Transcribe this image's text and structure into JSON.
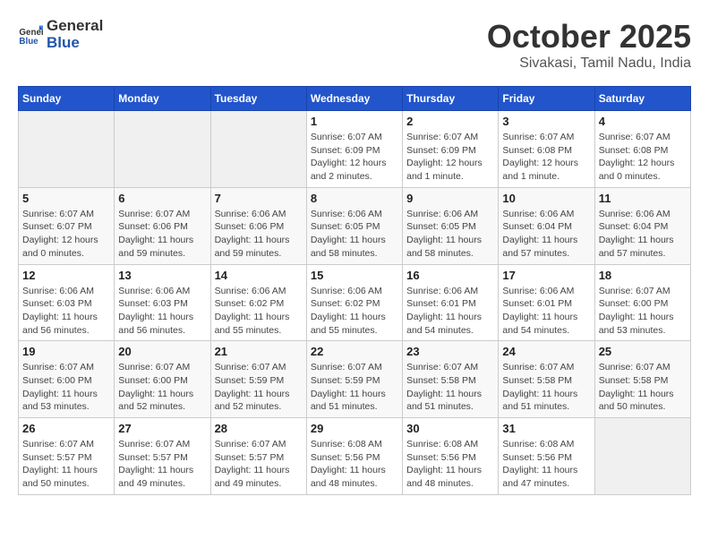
{
  "header": {
    "logo_general": "General",
    "logo_blue": "Blue",
    "title": "October 2025",
    "subtitle": "Sivakasi, Tamil Nadu, India"
  },
  "weekdays": [
    "Sunday",
    "Monday",
    "Tuesday",
    "Wednesday",
    "Thursday",
    "Friday",
    "Saturday"
  ],
  "weeks": [
    [
      {
        "day": "",
        "info": ""
      },
      {
        "day": "",
        "info": ""
      },
      {
        "day": "",
        "info": ""
      },
      {
        "day": "1",
        "info": "Sunrise: 6:07 AM\nSunset: 6:09 PM\nDaylight: 12 hours and 2 minutes."
      },
      {
        "day": "2",
        "info": "Sunrise: 6:07 AM\nSunset: 6:09 PM\nDaylight: 12 hours and 1 minute."
      },
      {
        "day": "3",
        "info": "Sunrise: 6:07 AM\nSunset: 6:08 PM\nDaylight: 12 hours and 1 minute."
      },
      {
        "day": "4",
        "info": "Sunrise: 6:07 AM\nSunset: 6:08 PM\nDaylight: 12 hours and 0 minutes."
      }
    ],
    [
      {
        "day": "5",
        "info": "Sunrise: 6:07 AM\nSunset: 6:07 PM\nDaylight: 12 hours and 0 minutes."
      },
      {
        "day": "6",
        "info": "Sunrise: 6:07 AM\nSunset: 6:06 PM\nDaylight: 11 hours and 59 minutes."
      },
      {
        "day": "7",
        "info": "Sunrise: 6:06 AM\nSunset: 6:06 PM\nDaylight: 11 hours and 59 minutes."
      },
      {
        "day": "8",
        "info": "Sunrise: 6:06 AM\nSunset: 6:05 PM\nDaylight: 11 hours and 58 minutes."
      },
      {
        "day": "9",
        "info": "Sunrise: 6:06 AM\nSunset: 6:05 PM\nDaylight: 11 hours and 58 minutes."
      },
      {
        "day": "10",
        "info": "Sunrise: 6:06 AM\nSunset: 6:04 PM\nDaylight: 11 hours and 57 minutes."
      },
      {
        "day": "11",
        "info": "Sunrise: 6:06 AM\nSunset: 6:04 PM\nDaylight: 11 hours and 57 minutes."
      }
    ],
    [
      {
        "day": "12",
        "info": "Sunrise: 6:06 AM\nSunset: 6:03 PM\nDaylight: 11 hours and 56 minutes."
      },
      {
        "day": "13",
        "info": "Sunrise: 6:06 AM\nSunset: 6:03 PM\nDaylight: 11 hours and 56 minutes."
      },
      {
        "day": "14",
        "info": "Sunrise: 6:06 AM\nSunset: 6:02 PM\nDaylight: 11 hours and 55 minutes."
      },
      {
        "day": "15",
        "info": "Sunrise: 6:06 AM\nSunset: 6:02 PM\nDaylight: 11 hours and 55 minutes."
      },
      {
        "day": "16",
        "info": "Sunrise: 6:06 AM\nSunset: 6:01 PM\nDaylight: 11 hours and 54 minutes."
      },
      {
        "day": "17",
        "info": "Sunrise: 6:06 AM\nSunset: 6:01 PM\nDaylight: 11 hours and 54 minutes."
      },
      {
        "day": "18",
        "info": "Sunrise: 6:07 AM\nSunset: 6:00 PM\nDaylight: 11 hours and 53 minutes."
      }
    ],
    [
      {
        "day": "19",
        "info": "Sunrise: 6:07 AM\nSunset: 6:00 PM\nDaylight: 11 hours and 53 minutes."
      },
      {
        "day": "20",
        "info": "Sunrise: 6:07 AM\nSunset: 6:00 PM\nDaylight: 11 hours and 52 minutes."
      },
      {
        "day": "21",
        "info": "Sunrise: 6:07 AM\nSunset: 5:59 PM\nDaylight: 11 hours and 52 minutes."
      },
      {
        "day": "22",
        "info": "Sunrise: 6:07 AM\nSunset: 5:59 PM\nDaylight: 11 hours and 51 minutes."
      },
      {
        "day": "23",
        "info": "Sunrise: 6:07 AM\nSunset: 5:58 PM\nDaylight: 11 hours and 51 minutes."
      },
      {
        "day": "24",
        "info": "Sunrise: 6:07 AM\nSunset: 5:58 PM\nDaylight: 11 hours and 51 minutes."
      },
      {
        "day": "25",
        "info": "Sunrise: 6:07 AM\nSunset: 5:58 PM\nDaylight: 11 hours and 50 minutes."
      }
    ],
    [
      {
        "day": "26",
        "info": "Sunrise: 6:07 AM\nSunset: 5:57 PM\nDaylight: 11 hours and 50 minutes."
      },
      {
        "day": "27",
        "info": "Sunrise: 6:07 AM\nSunset: 5:57 PM\nDaylight: 11 hours and 49 minutes."
      },
      {
        "day": "28",
        "info": "Sunrise: 6:07 AM\nSunset: 5:57 PM\nDaylight: 11 hours and 49 minutes."
      },
      {
        "day": "29",
        "info": "Sunrise: 6:08 AM\nSunset: 5:56 PM\nDaylight: 11 hours and 48 minutes."
      },
      {
        "day": "30",
        "info": "Sunrise: 6:08 AM\nSunset: 5:56 PM\nDaylight: 11 hours and 48 minutes."
      },
      {
        "day": "31",
        "info": "Sunrise: 6:08 AM\nSunset: 5:56 PM\nDaylight: 11 hours and 47 minutes."
      },
      {
        "day": "",
        "info": ""
      }
    ]
  ]
}
